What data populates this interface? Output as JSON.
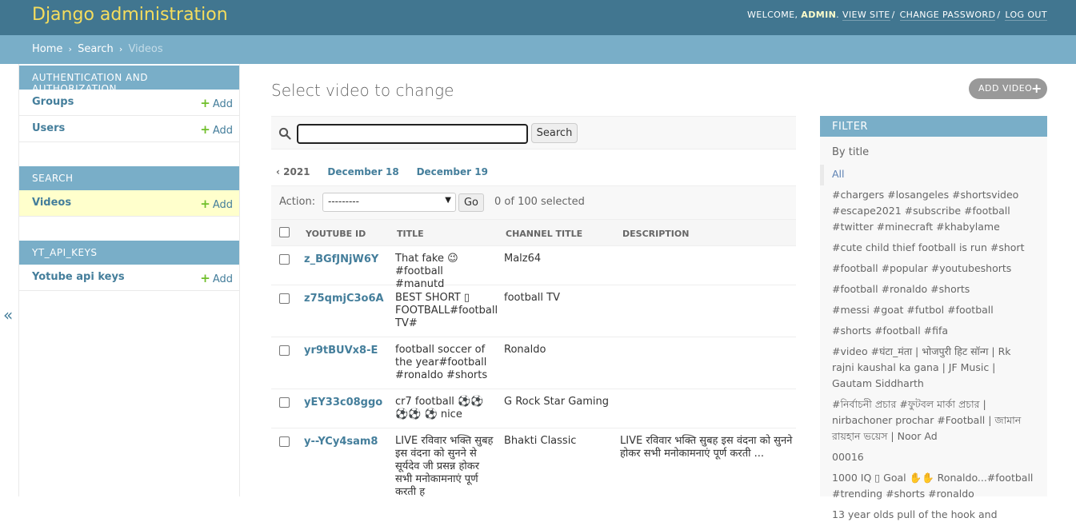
{
  "header": {
    "brand": "Django administration",
    "welcome": "Welcome,",
    "user": "admin",
    "view_site": "View site",
    "change_password": "Change password",
    "log_out": "Log out"
  },
  "breadcrumbs": {
    "home": "Home",
    "app": "Search",
    "current": "Videos",
    "sep": "›"
  },
  "sidebar": {
    "modules": [
      {
        "caption": "Authentication and Authorization",
        "rows": [
          {
            "label": "Groups",
            "add": "Add"
          },
          {
            "label": "Users",
            "add": "Add"
          }
        ]
      },
      {
        "caption": "Search",
        "rows": [
          {
            "label": "Videos",
            "add": "Add"
          }
        ]
      },
      {
        "caption": "YT_API_KEYS",
        "rows": [
          {
            "label": "Yotube api keys",
            "add": "Add"
          }
        ]
      }
    ],
    "toggle": "«"
  },
  "main": {
    "title": "Select video to change",
    "add_button": "Add video",
    "search": {
      "value": "",
      "button": "Search"
    },
    "date_hierarchy": {
      "back": "‹ 2021",
      "links": [
        "December 18",
        "December 19"
      ]
    },
    "actions": {
      "label": "Action:",
      "selected": "---------",
      "go": "Go",
      "count": "0 of 100 selected"
    },
    "table": {
      "headers": [
        "Youtube ID",
        "Title",
        "Channel title",
        "Description"
      ],
      "rows": [
        {
          "id": "z_BGfJNjW6Y",
          "title": "That fake 😉 #football #manutd",
          "channel": "Malz64",
          "description": ""
        },
        {
          "id": "z75qmjC3o6A",
          "title": "BEST SHORT ▯ FOOTBALL#football TV#",
          "channel": "football TV",
          "description": ""
        },
        {
          "id": "yr9tBUVx8-E",
          "title": "football soccer of the year#football #ronaldo #shorts",
          "channel": "Ronaldo",
          "description": ""
        },
        {
          "id": "yEY33c08ggo",
          "title": "cr7 football ⚽⚽⚽⚽ ⚽ nice",
          "channel": "G Rock Star Gaming",
          "description": ""
        },
        {
          "id": "y--YCy4sam8",
          "title": "LIVE रविवार भक्ति सुबह इस वंदना को सुनने से सूर्यदेव जी प्रसन्न होकर सभी मनोकामनाएं पूर्ण करती ह",
          "channel": "Bhakti Classic",
          "description": "LIVE रविवार भक्ति सुबह इस वंदना को सुनने होकर सभी मनोकामनाएं पूर्ण करती ..."
        }
      ]
    }
  },
  "filter": {
    "title": "Filter",
    "by": "By title",
    "items": [
      "All",
      "#chargers #losangeles #shortsvideo #escape2021 #subscribe #football #twitter #minecraft #khabylame",
      "#cute child thief football is run #short",
      "#football #popular #youtubeshorts",
      "#football #ronaldo #shorts",
      "#messi #goat #futbol #football",
      "#shorts #football #fifa",
      "#video #घंटा_मंता | भोजपुरी हिट सॉन्ग | Rk rajni kaushal ka gana | JF Music | Gautam Siddharth",
      "#নির্বাচনী প্রচার #ফুটবল মার্কা প্রচার | nirbachoner prochar #Football | জামান রায়হান ভয়েস | Noor Ad",
      "00016",
      "1000 IQ ▯ Goal ✋✋ Ronaldo...#football #trending #shorts #ronaldo",
      "13 year olds pull of the hook and"
    ]
  },
  "colors": {
    "header_bg": "#417690",
    "brand": "#f5dd5d",
    "breadcrumb_bg": "#79aec8",
    "link": "#447e9b",
    "add_plus": "#70bf2b",
    "active_row": "#ffffcc"
  }
}
